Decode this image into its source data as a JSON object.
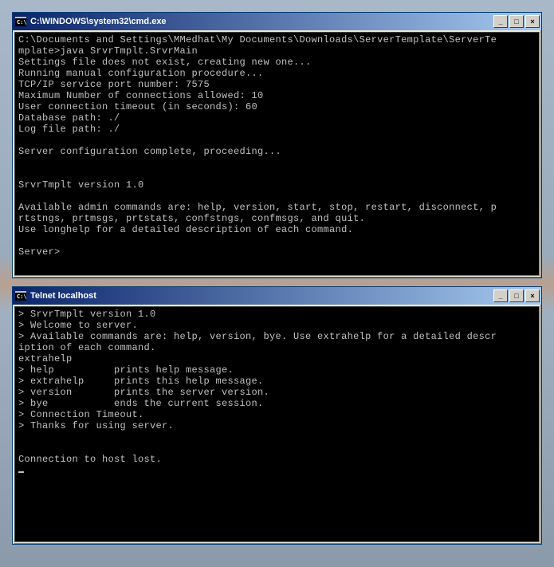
{
  "windows": [
    {
      "icon_label": "cmd-icon",
      "title": "C:\\WINDOWS\\system32\\cmd.exe",
      "body": "C:\\Documents and Settings\\MMedhat\\My Documents\\Downloads\\ServerTemplate\\ServerTe\nmplate>java SrvrTmplt.SrvrMain\nSettings file does not exist, creating new one...\nRunning manual configuration procedure...\nTCP/IP service port number: 7575\nMaximum Number of connections allowed: 10\nUser connection timeout (in seconds): 60\nDatabase path: ./\nLog file path: ./\n\nServer configuration complete, proceeding...\n\n\nSrvrTmplt version 1.0\n\nAvailable admin commands are: help, version, start, stop, restart, disconnect, p\nrtstngs, prtmsgs, prtstats, confstngs, confmsgs, and quit.\nUse longhelp for a detailed description of each command.\n\nServer>"
    },
    {
      "icon_label": "cmd-icon",
      "title": "Telnet localhost",
      "body": "> SrvrTmplt version 1.0\n> Welcome to server.\n> Available commands are: help, version, bye. Use extrahelp for a detailed descr\niption of each command.\nextrahelp\n> help          prints help message.\n> extrahelp     prints this help message.\n> version       prints the server version.\n> bye           ends the current session.\n> Connection Timeout.\n> Thanks for using server.\n\n\nConnection to host lost.\n"
    }
  ],
  "buttons": {
    "minimize": "_",
    "maximize": "□",
    "close": "×"
  }
}
